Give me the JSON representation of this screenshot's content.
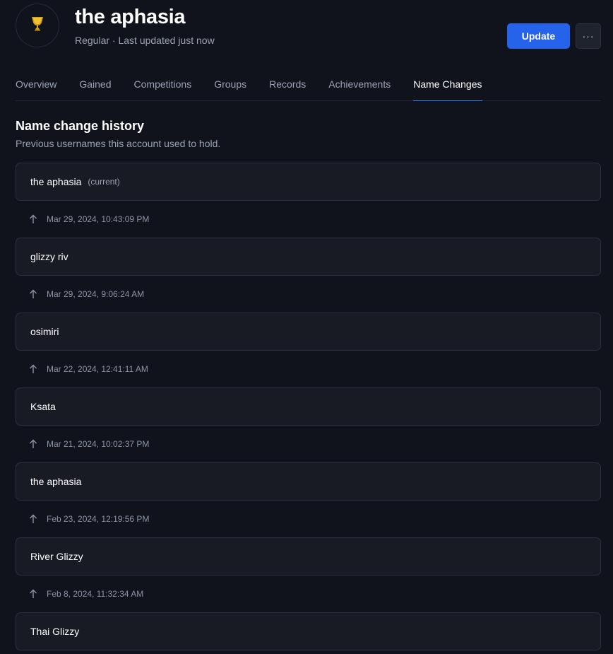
{
  "player": {
    "name": "the aphasia",
    "subtitle": "Regular · Last updated just now",
    "avatar_icon": "trophy-icon"
  },
  "actions": {
    "update_label": "Update",
    "more_label": "···"
  },
  "tabs": [
    {
      "label": "Overview",
      "active": false
    },
    {
      "label": "Gained",
      "active": false
    },
    {
      "label": "Competitions",
      "active": false
    },
    {
      "label": "Groups",
      "active": false
    },
    {
      "label": "Records",
      "active": false
    },
    {
      "label": "Achievements",
      "active": false
    },
    {
      "label": "Name Changes",
      "active": true
    }
  ],
  "section": {
    "title": "Name change history",
    "description": "Previous usernames this account used to hold."
  },
  "history": {
    "current_tag": "(current)",
    "names": [
      "the aphasia",
      "glizzy riv",
      "osimiri",
      "Ksata",
      "the aphasia",
      "River Glizzy",
      "Thai Glizzy"
    ],
    "changes": [
      "Mar 29, 2024, 10:43:09 PM",
      "Mar 29, 2024, 9:06:24 AM",
      "Mar 22, 2024, 12:41:11 AM",
      "Mar 21, 2024, 10:02:37 PM",
      "Feb 23, 2024, 12:19:56 PM",
      "Feb 8, 2024, 11:32:34 AM"
    ]
  },
  "colors": {
    "background": "#10131b",
    "accent": "#2563eb",
    "tab_underline": "#3b82f6",
    "card_bg": "#181b24",
    "card_border": "#2a303c",
    "muted_text": "#9aa3b5"
  }
}
